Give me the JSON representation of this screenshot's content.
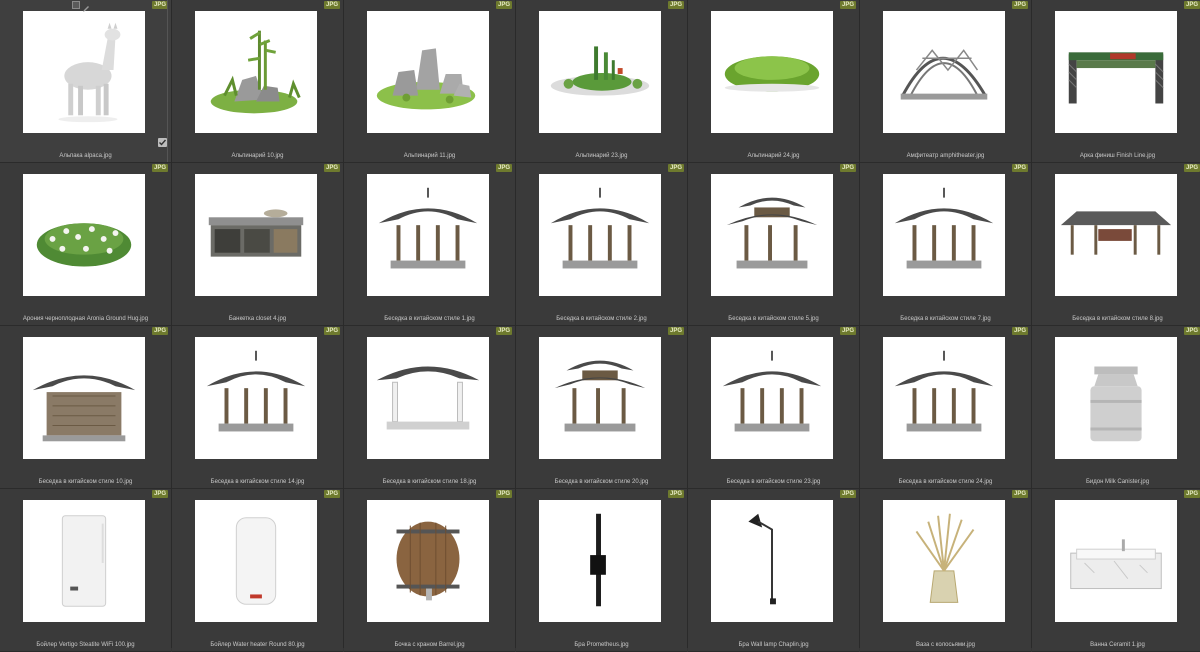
{
  "badge_label": "JPG",
  "selected_index": 0,
  "items": [
    {
      "name": "Альпака alpaca.jpg",
      "icon": "alpaca"
    },
    {
      "name": "Альпинарий 10.jpg",
      "icon": "rock-garden-bamboo"
    },
    {
      "name": "Альпинарий 11.jpg",
      "icon": "rock-garden"
    },
    {
      "name": "Альпинарий 23.jpg",
      "icon": "rock-garden-cactus"
    },
    {
      "name": "Альпинарий 24.jpg",
      "icon": "grass-mound"
    },
    {
      "name": "Амфитеатр amphitheater.jpg",
      "icon": "amphitheater"
    },
    {
      "name": "Арка финиш Finish Line.jpg",
      "icon": "finish-arch"
    },
    {
      "name": "Арония черноплодная Aronia Ground Hug.jpg",
      "icon": "flower-bush"
    },
    {
      "name": "Банкетка closet 4.jpg",
      "icon": "bench-closet"
    },
    {
      "name": "Беседка в китайском стиле 1.jpg",
      "icon": "pavilion"
    },
    {
      "name": "Беседка в китайском стиле 2.jpg",
      "icon": "pavilion"
    },
    {
      "name": "Беседка в китайском стиле 5.jpg",
      "icon": "pavilion-double"
    },
    {
      "name": "Беседка в китайском стиле 7.jpg",
      "icon": "pavilion"
    },
    {
      "name": "Беседка в китайском стиле 8.jpg",
      "icon": "pavilion-long"
    },
    {
      "name": "Беседка в китайском стиле 10.jpg",
      "icon": "pavilion-closed"
    },
    {
      "name": "Беседка в китайском стиле 14.jpg",
      "icon": "pavilion"
    },
    {
      "name": "Беседка в китайском стиле 18.jpg",
      "icon": "pavilion-white"
    },
    {
      "name": "Беседка в китайском стиле 20.jpg",
      "icon": "pavilion-double"
    },
    {
      "name": "Беседка в китайском стиле 23.jpg",
      "icon": "pavilion"
    },
    {
      "name": "Беседка в китайском стиле 24.jpg",
      "icon": "pavilion"
    },
    {
      "name": "Бидон Milk Canister.jpg",
      "icon": "milk-can"
    },
    {
      "name": "Бойлер Vertigo Steatite WiFi 100.jpg",
      "icon": "boiler-flat"
    },
    {
      "name": "Бойлер Water heater Round 80.jpg",
      "icon": "boiler-round"
    },
    {
      "name": "Бочка с краном Barrel.jpg",
      "icon": "barrel"
    },
    {
      "name": "Бра Prometheus.jpg",
      "icon": "wall-lamp-bar"
    },
    {
      "name": "Бра Wall lamp Chaplin.jpg",
      "icon": "wall-lamp-arm"
    },
    {
      "name": "Ваза с колосьями.jpg",
      "icon": "vase-wheat"
    },
    {
      "name": "Ванна Ceramit 1.jpg",
      "icon": "bathtub"
    }
  ]
}
